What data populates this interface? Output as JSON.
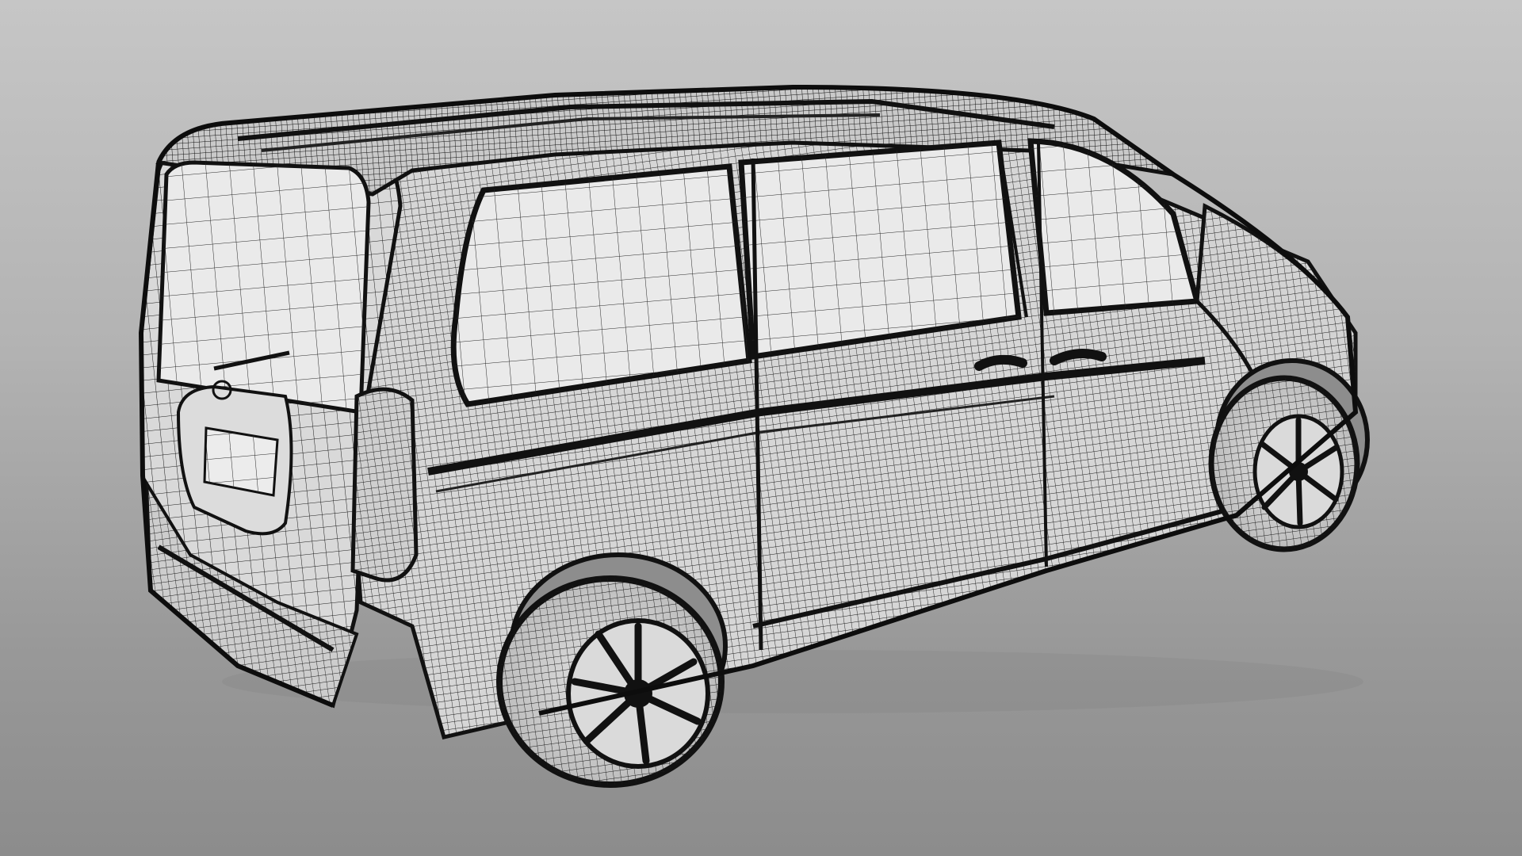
{
  "viewport": {
    "background_top": "#c6c6c6",
    "background_bottom": "#8c8c8c"
  },
  "model": {
    "subject": "van-wireframe",
    "render_mode": "wireframe",
    "wire_color": "#1a1a1a",
    "surface_color": "#d9d9d9",
    "glass_color": "#e8e8e8"
  }
}
